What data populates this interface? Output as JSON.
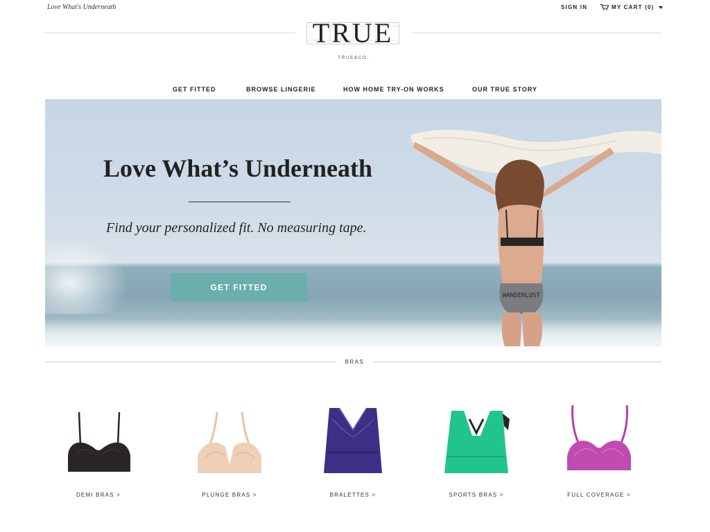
{
  "header": {
    "tagline": "Love What's Underneath",
    "sign_in": "SIGN IN",
    "cart_label": "MY CART (0)",
    "logo_text": "TRUE",
    "logo_subtext": "TRUE&CO."
  },
  "nav": {
    "items": [
      {
        "label": "GET FITTED"
      },
      {
        "label": "BROWSE LINGERIE"
      },
      {
        "label": "HOW HOME TRY-ON WORKS"
      },
      {
        "label": "OUR TRUE STORY"
      }
    ]
  },
  "hero": {
    "title": "Love What’s Underneath",
    "subtitle": "Find your personalized fit. No measuring tape.",
    "cta_label": "GET FITTED",
    "image_text": "WANDERLUST"
  },
  "section": {
    "label": "BRAS"
  },
  "products": [
    {
      "label": "DEMI BRAS >",
      "color": "#2a2526"
    },
    {
      "label": "PLUNGE BRAS >",
      "color": "#e9c9ae"
    },
    {
      "label": "BRALETTES >",
      "color": "#3b2f86"
    },
    {
      "label": "SPORTS BRAS >",
      "color": "#21c48a"
    },
    {
      "label": "FULL COVERAGE >",
      "color": "#b83ea8"
    }
  ],
  "colors": {
    "cta": "#6aaeae",
    "text": "#222222"
  }
}
